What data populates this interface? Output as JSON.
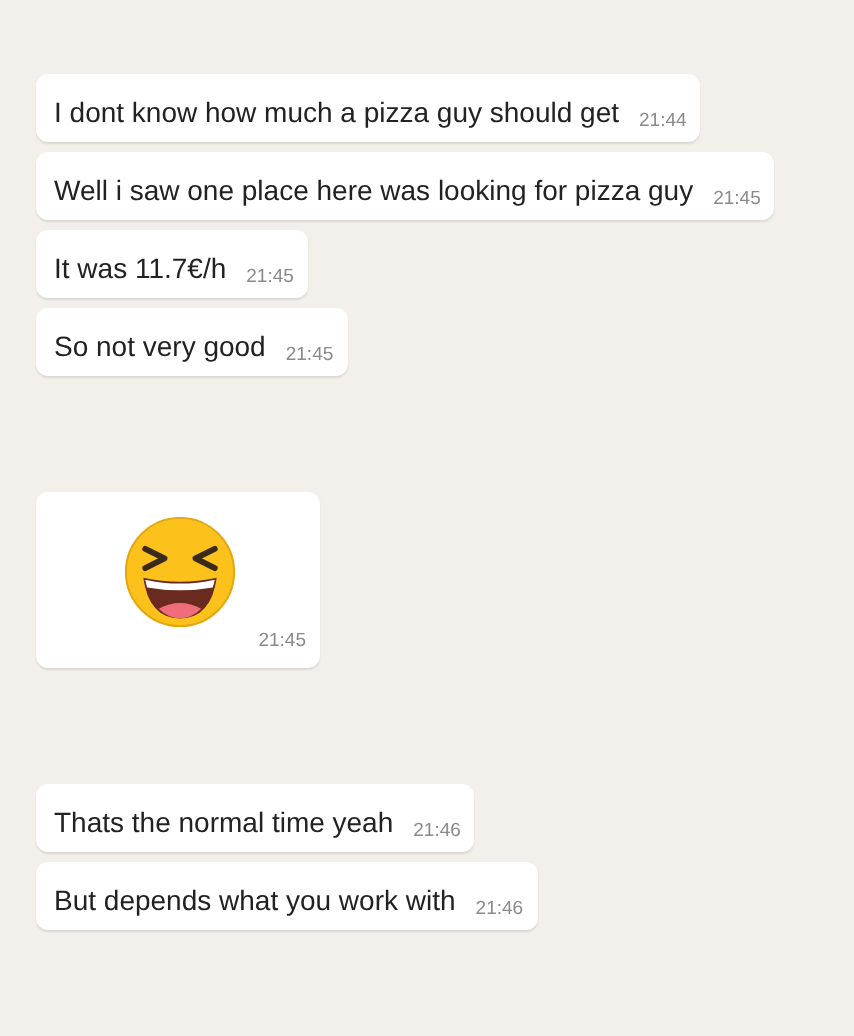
{
  "groups": [
    {
      "messages": [
        {
          "kind": "text",
          "text": "I dont know how much a pizza guy should get",
          "time": "21:44"
        },
        {
          "kind": "text",
          "text": "Well i saw one place here was looking for pizza guy",
          "time": "21:45"
        },
        {
          "kind": "text",
          "text": "It was 11.7€/h",
          "time": "21:45"
        },
        {
          "kind": "text",
          "text": "So not very good",
          "time": "21:45"
        }
      ]
    },
    {
      "messages": [
        {
          "kind": "emoji",
          "time": "21:45"
        }
      ]
    },
    {
      "messages": [
        {
          "kind": "text",
          "text": "Thats the normal time yeah",
          "time": "21:46"
        },
        {
          "kind": "text",
          "text": "But depends what you work with",
          "time": "21:46"
        }
      ]
    }
  ]
}
